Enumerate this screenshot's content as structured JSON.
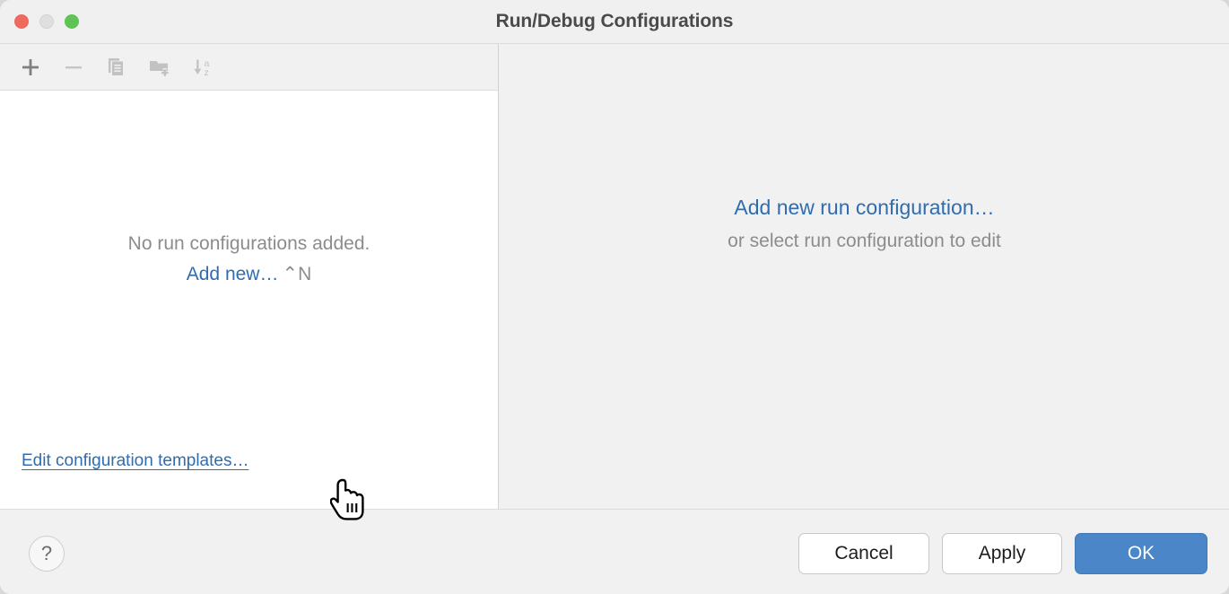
{
  "window": {
    "title": "Run/Debug Configurations",
    "traffic_lights": [
      {
        "name": "close",
        "color": "#ec6a5e"
      },
      {
        "name": "minimize",
        "color": "#dfdfdf"
      },
      {
        "name": "zoom",
        "color": "#5fc456"
      }
    ]
  },
  "toolbar": {
    "buttons": [
      {
        "name": "add",
        "icon": "plus-icon",
        "enabled": true
      },
      {
        "name": "remove",
        "icon": "minus-icon",
        "enabled": false
      },
      {
        "name": "copy",
        "icon": "copy-icon",
        "enabled": false
      },
      {
        "name": "new-folder",
        "icon": "folder-add-icon",
        "enabled": false
      },
      {
        "name": "sort",
        "icon": "sort-alpha-icon",
        "enabled": false
      }
    ]
  },
  "left_panel": {
    "empty_message": "No run configurations added.",
    "add_new_label": "Add new…",
    "add_new_shortcut": "⌃N",
    "edit_templates_label": "Edit configuration templates…"
  },
  "right_panel": {
    "add_new_label": "Add new run configuration…",
    "hint": "or select run configuration to edit"
  },
  "footer": {
    "help_label": "?",
    "cancel_label": "Cancel",
    "apply_label": "Apply",
    "ok_label": "OK"
  },
  "colors": {
    "link": "#2f6cb0",
    "primary_button": "#4a86c8",
    "muted_text": "#8c8c8c",
    "panel_bg": "#f1f1f1",
    "list_bg": "#ffffff"
  }
}
